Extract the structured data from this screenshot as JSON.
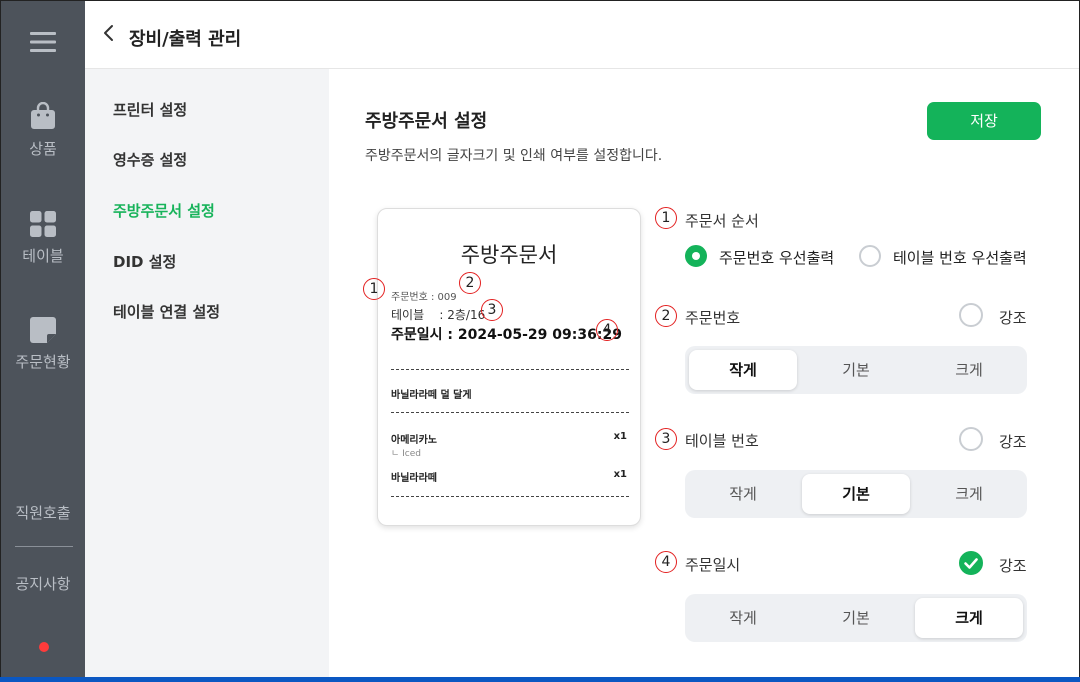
{
  "rail": {
    "items": [
      {
        "label": ""
      },
      {
        "label": "상품"
      },
      {
        "label": "테이블"
      },
      {
        "label": "주문현황"
      },
      {
        "label": "직원호출"
      },
      {
        "label": "공지사항"
      }
    ]
  },
  "header": {
    "title": "장비/출력 관리"
  },
  "subnav": {
    "items": [
      "프린터 설정",
      "영수증 설정",
      "주방주문서 설정",
      "DID 설정",
      "테이블 연결 설정"
    ],
    "active_index": 2
  },
  "main": {
    "title": "주방주문서 설정",
    "description": "주방주문서의 글자크기 및 인쇄 여부를 설정합니다.",
    "save_label": "저장"
  },
  "receipt": {
    "title": "주방주문서",
    "order_no": "주문번호 : 009",
    "table": "테이블    : 2층/16",
    "order_time": "주문일시 : 2024-05-29 09:36:29",
    "note_item": "바닐라라떼 덜 달게",
    "items": [
      {
        "name": "아메리카노",
        "sub": "ㄴ Iced",
        "qty": "x1"
      },
      {
        "name": "바닐라라떼",
        "sub": "",
        "qty": "x1"
      }
    ]
  },
  "markers": [
    "1",
    "2",
    "3",
    "4"
  ],
  "settings": {
    "order": {
      "label": "주문서 순서",
      "options": [
        "주문번호 우선출력",
        "테이블 번호 우선출력"
      ],
      "selected": 0
    },
    "order_no": {
      "label": "주문번호",
      "emphasis_label": "강조",
      "emphasis": false,
      "sizes": [
        "작게",
        "기본",
        "크게"
      ],
      "selected": 0
    },
    "table_no": {
      "label": "테이블 번호",
      "emphasis_label": "강조",
      "emphasis": false,
      "sizes": [
        "작게",
        "기본",
        "크게"
      ],
      "selected": 1
    },
    "order_time": {
      "label": "주문일시",
      "emphasis_label": "강조",
      "emphasis": true,
      "sizes": [
        "작게",
        "기본",
        "크게"
      ],
      "selected": 2
    }
  },
  "colors": {
    "accent": "#14b35a",
    "rail": "#4d535b",
    "marker": "#e32020"
  }
}
